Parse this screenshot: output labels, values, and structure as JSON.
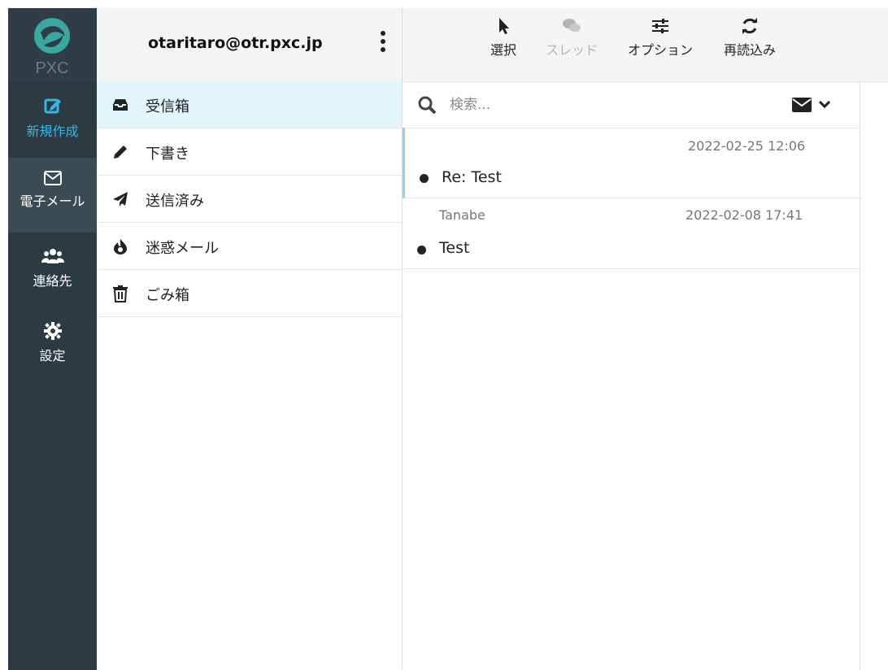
{
  "app": {
    "brand": "PXC"
  },
  "rail": {
    "items": [
      {
        "label": "新規作成",
        "icon": "compose-icon"
      },
      {
        "label": "電子メール",
        "icon": "envelope-icon"
      },
      {
        "label": "連絡先",
        "icon": "contacts-icon"
      },
      {
        "label": "設定",
        "icon": "gear-icon"
      }
    ],
    "accent": "#37b5e7",
    "background": "#2c3a42"
  },
  "account": {
    "email": "otaritaro@otr.pxc.jp"
  },
  "folders": [
    {
      "label": "受信箱",
      "icon": "inbox-icon",
      "selected": true
    },
    {
      "label": "下書き",
      "icon": "pencil-icon"
    },
    {
      "label": "送信済み",
      "icon": "paper-plane-icon"
    },
    {
      "label": "迷惑メール",
      "icon": "fire-icon"
    },
    {
      "label": "ごみ箱",
      "icon": "trash-icon"
    }
  ],
  "toolbar": {
    "select": "選択",
    "thread": "スレッド",
    "options": "オプション",
    "reload": "再読込み"
  },
  "search": {
    "placeholder": "検索..."
  },
  "messages": [
    {
      "from": "",
      "date": "2022-02-25 12:06",
      "subject": "Re: Test"
    },
    {
      "from": "Tanabe",
      "date": "2022-02-08 17:41",
      "subject": "Test"
    }
  ]
}
